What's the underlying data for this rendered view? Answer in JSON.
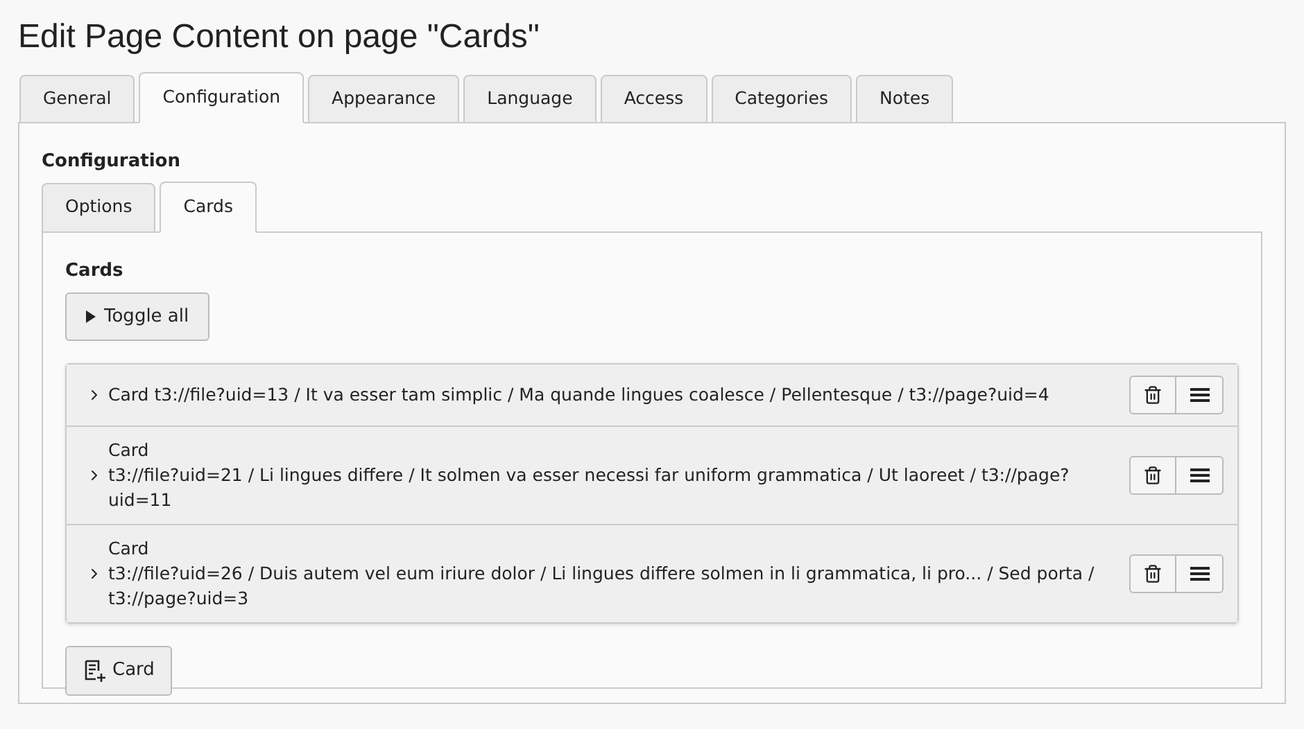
{
  "title": "Edit Page Content on page \"Cards\"",
  "tabs": [
    {
      "label": "General",
      "selected": false
    },
    {
      "label": "Configuration",
      "selected": true
    },
    {
      "label": "Appearance",
      "selected": false
    },
    {
      "label": "Language",
      "selected": false
    },
    {
      "label": "Access",
      "selected": false
    },
    {
      "label": "Categories",
      "selected": false
    },
    {
      "label": "Notes",
      "selected": false
    }
  ],
  "section_title": "Configuration",
  "subtabs": [
    {
      "label": "Options",
      "selected": false
    },
    {
      "label": "Cards",
      "selected": true
    }
  ],
  "field_label": "Cards",
  "toggle_button": "Toggle all",
  "cards": [
    {
      "label": "Card",
      "summary": "t3://file?uid=13 / It va esser tam simplic / Ma quande lingues coalesce / Pellentesque / t3://page?uid=4",
      "expanded": false
    },
    {
      "label": "Card",
      "summary": "t3://file?uid=21 / Li lingues differe / It solmen va esser necessi far uniform grammatica / Ut laoreet / t3://page?uid=11",
      "expanded": false
    },
    {
      "label": "Card",
      "summary": "t3://file?uid=26 / Duis autem vel eum iriure dolor / Li lingues differe solmen in li grammatica, li pro... / Sed porta / t3://page?uid=3",
      "expanded": false
    }
  ],
  "add_button": "Card"
}
